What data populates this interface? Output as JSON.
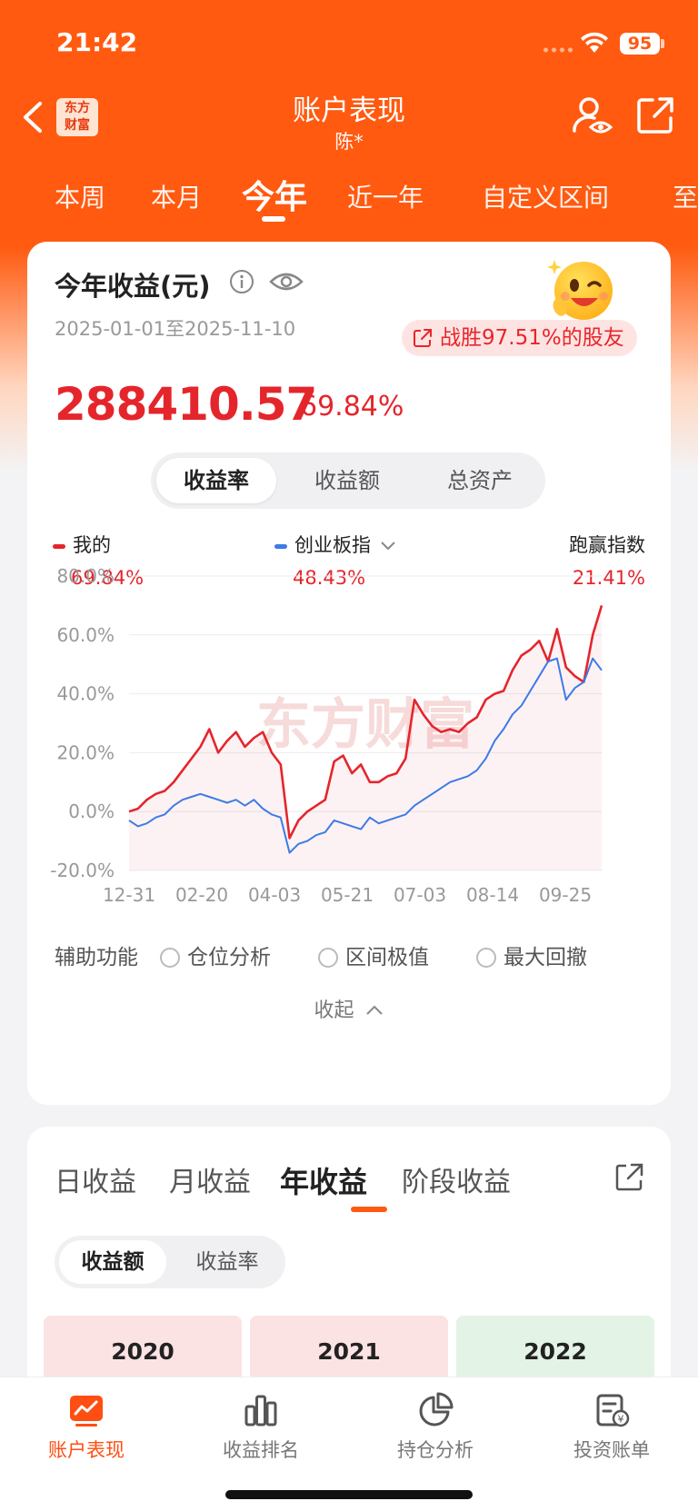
{
  "status_bar": {
    "time": "21:42",
    "battery": "95"
  },
  "nav": {
    "logo_line1": "东方",
    "logo_line2": "财富",
    "title": "账户表现",
    "subtitle": "陈*"
  },
  "period_tabs": [
    {
      "label": "本周",
      "active": false
    },
    {
      "label": "本月",
      "active": false
    },
    {
      "label": "今年",
      "active": true
    },
    {
      "label": "近一年",
      "active": false
    },
    {
      "label": "自定义区间",
      "active": false
    },
    {
      "label": "至",
      "active": false
    }
  ],
  "summary": {
    "title": "今年收益(元)",
    "date_range": "2025-01-01至2025-11-10",
    "beat_badge": "战胜97.51%的股友",
    "value": "288410.57",
    "percent": "69.84%"
  },
  "chart_toggle": {
    "options": [
      "收益率",
      "收益额",
      "总资产"
    ],
    "active": 0
  },
  "legend": {
    "mine": {
      "label": "我的",
      "value": "69.84%",
      "color": "#e5252c"
    },
    "index": {
      "label": "创业板指",
      "value": "48.43%",
      "color": "#3d7be6"
    },
    "beat": {
      "label": "跑赢指数",
      "value": "21.41%"
    }
  },
  "chart_data": {
    "type": "line",
    "ylim": [
      -20,
      80
    ],
    "y_ticks": [
      "80.0%",
      "60.0%",
      "40.0%",
      "20.0%",
      "0.0%",
      "-20.0%"
    ],
    "x_ticks": [
      "12-31",
      "02-20",
      "04-03",
      "05-21",
      "07-03",
      "08-14",
      "09-25"
    ],
    "watermark": "东方财富",
    "series": [
      {
        "name": "我的",
        "color": "#e5252c",
        "values": [
          0,
          1,
          4,
          6,
          7,
          10,
          14,
          18,
          22,
          28,
          20,
          24,
          27,
          22,
          25,
          27,
          20,
          16,
          -9,
          -3,
          0,
          2,
          4,
          17,
          19,
          13,
          16,
          10,
          10,
          12,
          13,
          18,
          38,
          33,
          29,
          27,
          28,
          27,
          30,
          32,
          38,
          40,
          41,
          48,
          53,
          55,
          58,
          51,
          62,
          49,
          46,
          44,
          60,
          70
        ]
      },
      {
        "name": "创业板指",
        "color": "#3d7be6",
        "values": [
          -3,
          -5,
          -4,
          -2,
          -1,
          2,
          4,
          5,
          6,
          5,
          4,
          3,
          4,
          2,
          4,
          1,
          -1,
          -2,
          -14,
          -11,
          -10,
          -8,
          -7,
          -3,
          -4,
          -5,
          -6,
          -2,
          -4,
          -3,
          -2,
          -1,
          2,
          4,
          6,
          8,
          10,
          11,
          12,
          14,
          18,
          24,
          28,
          33,
          36,
          41,
          46,
          51,
          52,
          38,
          42,
          44,
          52,
          48
        ]
      }
    ]
  },
  "aux": {
    "label": "辅助功能",
    "options": [
      "仓位分析",
      "区间极值",
      "最大回撤"
    ]
  },
  "collapse_label": "收起",
  "returns_tabs": {
    "items": [
      "日收益",
      "月收益",
      "年收益",
      "阶段收益"
    ],
    "active": 2
  },
  "returns_toggle": {
    "options": [
      "收益额",
      "收益率"
    ],
    "active": 0
  },
  "years": [
    {
      "label": "2020",
      "color": "#fbe3e3"
    },
    {
      "label": "2021",
      "color": "#fbe3e3"
    },
    {
      "label": "2022",
      "color": "#e3f3e5"
    }
  ],
  "tabbar": [
    {
      "label": "账户表现",
      "icon": "chart-line-icon",
      "active": true
    },
    {
      "label": "收益排名",
      "icon": "bar-chart-icon",
      "active": false
    },
    {
      "label": "持仓分析",
      "icon": "pie-chart-icon",
      "active": false
    },
    {
      "label": "投资账单",
      "icon": "bill-icon",
      "active": false
    }
  ]
}
